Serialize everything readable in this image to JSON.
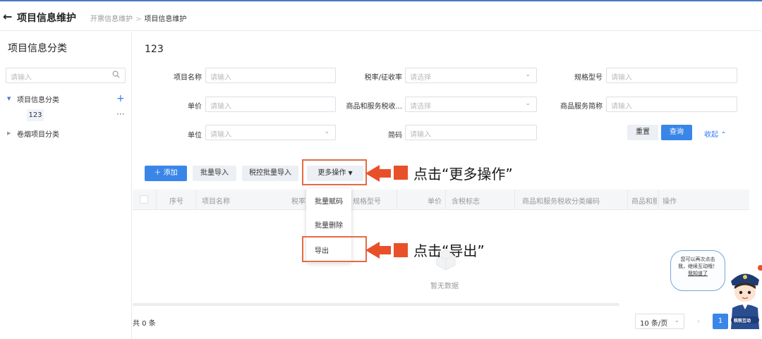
{
  "header": {
    "back_icon": "arrow-left-icon",
    "title": "项目信息维护",
    "breadcrumb": [
      "开票信息维护",
      "项目信息维护"
    ],
    "separator": ">"
  },
  "sidebar": {
    "title": "项目信息分类",
    "search_placeholder": "请输入",
    "tree": [
      {
        "label": "项目信息分类",
        "expanded": true,
        "children": [
          {
            "label": "123",
            "selected": true
          }
        ]
      },
      {
        "label": "卷烟项目分类",
        "expanded": false
      }
    ],
    "add_glyph": "+",
    "more_glyph": "···"
  },
  "main": {
    "title": "123",
    "filters": {
      "project_name": {
        "label": "项目名称",
        "placeholder": "请输入"
      },
      "tax_rate": {
        "label": "税率/征收率",
        "placeholder": "请选择"
      },
      "spec_model": {
        "label": "规格型号",
        "placeholder": "请输入"
      },
      "unit_price": {
        "label": "单价",
        "placeholder": "请输入"
      },
      "goods_tax_code": {
        "label": "商品和服务税收...",
        "placeholder": "请选择"
      },
      "goods_short": {
        "label": "商品服务简称",
        "placeholder": "请输入"
      },
      "unit": {
        "label": "单位",
        "placeholder": "请输入"
      },
      "short_code": {
        "label": "简码",
        "placeholder": "请输入"
      }
    },
    "filter_buttons": {
      "reset": "重置",
      "query": "查询",
      "collapse": "收起"
    },
    "toolbar": {
      "add": "添加",
      "batch_import": "批量导入",
      "tax_batch_import": "税控批量导入",
      "more_ops": "更多操作"
    },
    "more_menu": [
      "批量赋码",
      "批量删除",
      "导出"
    ],
    "table": {
      "columns": [
        "序号",
        "项目名称",
        "税率",
        "规格型号",
        "单价",
        "含税标志",
        "商品和服务税收分类编码",
        "商品和服",
        "操作"
      ],
      "empty_text": "暂无数据"
    },
    "pagination": {
      "total": "共 0 条",
      "page_size": "10 条/页",
      "current_page": "1"
    }
  },
  "annotations": {
    "more_ops_note": "点击“更多操作”",
    "export_note": "点击“导出”",
    "accent_color": "#e8502a"
  },
  "assistant": {
    "bubble_lines": [
      "您可以再次点击",
      "我，继续互动哦！"
    ],
    "bubble_link": "我知道了",
    "badge": "税税互动"
  }
}
